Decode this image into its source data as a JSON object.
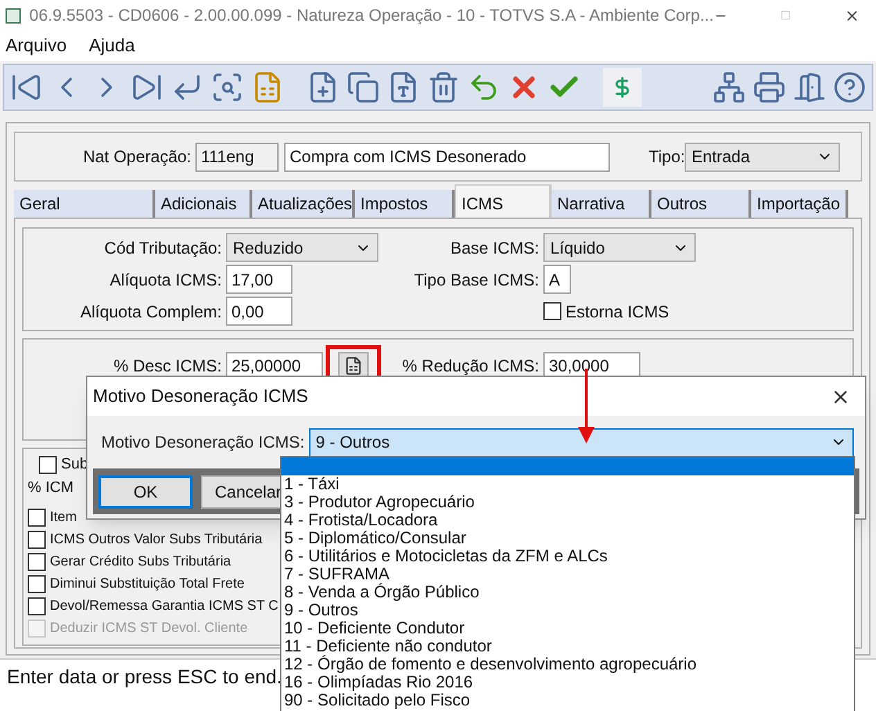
{
  "window": {
    "title": "06.9.5503 - CD0606 - 2.00.00.099 - Natureza Operação - 10 - TOTVS S.A - Ambiente Corp..."
  },
  "menu": [
    "Arquivo",
    "Ajuda"
  ],
  "header": {
    "nat_label": "Nat Operação:",
    "nat_code": "111eng",
    "nat_desc": "Compra com ICMS Desonerado",
    "tipo_label": "Tipo:",
    "tipo_value": "Entrada"
  },
  "tabs": [
    {
      "label": "Geral",
      "selected": false
    },
    {
      "label": "Adicionais",
      "selected": false
    },
    {
      "label": "Atualizações",
      "selected": false
    },
    {
      "label": "Impostos",
      "selected": false
    },
    {
      "label": "ICMS",
      "selected": true
    },
    {
      "label": "Narrativa",
      "selected": false
    },
    {
      "label": "Outros",
      "selected": false
    },
    {
      "label": "Importação",
      "selected": false
    }
  ],
  "group1": {
    "cod_trib": {
      "label": "Cód Tributação:",
      "value": "Reduzido"
    },
    "base_icms": {
      "label": "Base ICMS:",
      "value": "Líquido"
    },
    "aliquota": {
      "label": "Alíquota ICMS:",
      "value": "17,00"
    },
    "tipo_base": {
      "label": "Tipo Base ICMS:",
      "value": "A"
    },
    "complem": {
      "label": "Alíquota Complem:",
      "value": "0,00"
    },
    "estorna": {
      "label": "Estorna ICMS",
      "checked": false
    }
  },
  "group2": {
    "desc": {
      "label": "% Desc ICMS:",
      "value": "25,00000"
    },
    "reducao": {
      "label": "% Redução ICMS:",
      "value": "30,0000"
    }
  },
  "group3": {
    "sub": {
      "label": "Sub",
      "checked": false
    },
    "pct_label": "% ICM",
    "checkboxes": [
      {
        "label": "Item",
        "checked": false,
        "disabled": false
      },
      {
        "label": "ICMS Outros Valor Subs Tributária",
        "checked": false,
        "disabled": false
      },
      {
        "label": "Gerar Crédito Subs Tributária",
        "checked": false,
        "disabled": false
      },
      {
        "label": "Diminui Substituição Total Frete",
        "checked": false,
        "disabled": false
      },
      {
        "label": "Devol/Remessa Garantia ICMS ST C",
        "checked": false,
        "disabled": false
      },
      {
        "label": "Deduzir ICMS ST Devol. Cliente",
        "checked": false,
        "disabled": true
      }
    ]
  },
  "status_bar": "Enter data or press ESC to end.",
  "dialog": {
    "title": "Motivo Desoneração ICMS",
    "field_label": "Motivo Desoneração ICMS:",
    "value": "9 - Outros",
    "blank_option_highlighted": true,
    "buttons": [
      {
        "label": "OK",
        "default": true
      },
      {
        "label": "Cancelar",
        "default": false
      }
    ],
    "options": [
      "1 - Táxi",
      "3 - Produtor Agropecuário",
      "4 - Frotista/Locadora",
      "5 - Diplomático/Consular",
      "6 - Utilitários e Motocicletas da ZFM e ALCs",
      "7 - SUFRAMA",
      "8 - Venda a Órgão Público",
      "9 - Outros",
      "10 - Deficiente Condutor",
      "11 - Deficiente não condutor",
      "12 - Órgão de fomento e desenvolvimento agropecuário",
      "16 - Olimpíadas Rio 2016",
      "90 - Solicitado pelo Fisco"
    ]
  }
}
